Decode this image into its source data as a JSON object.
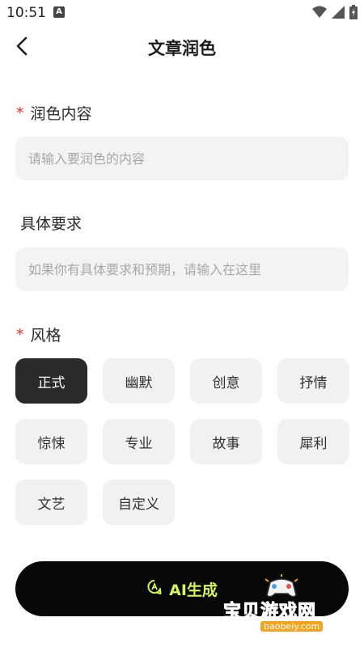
{
  "status_bar": {
    "time": "10:51",
    "notification_glyph": "A"
  },
  "header": {
    "title": "文章润色"
  },
  "content_section": {
    "label": "润色内容",
    "required_mark": "*",
    "placeholder": "请输入要润色的内容"
  },
  "requirements_section": {
    "label": "具体要求",
    "placeholder": "如果你有具体要求和预期，请输入在这里"
  },
  "style_section": {
    "label": "风格",
    "required_mark": "*",
    "options": [
      "正式",
      "幽默",
      "创意",
      "抒情",
      "惊悚",
      "专业",
      "故事",
      "犀利",
      "文艺",
      "自定义"
    ],
    "selected": "正式"
  },
  "generate_button": {
    "label": "AI生成"
  },
  "watermark": {
    "text": "宝贝游戏网",
    "url": "baobeiy.com"
  },
  "colors": {
    "accent": "#d4f45a",
    "required": "#e0312b",
    "selected_chip": "#2a2a2a",
    "field_bg": "#f3f3f3"
  }
}
